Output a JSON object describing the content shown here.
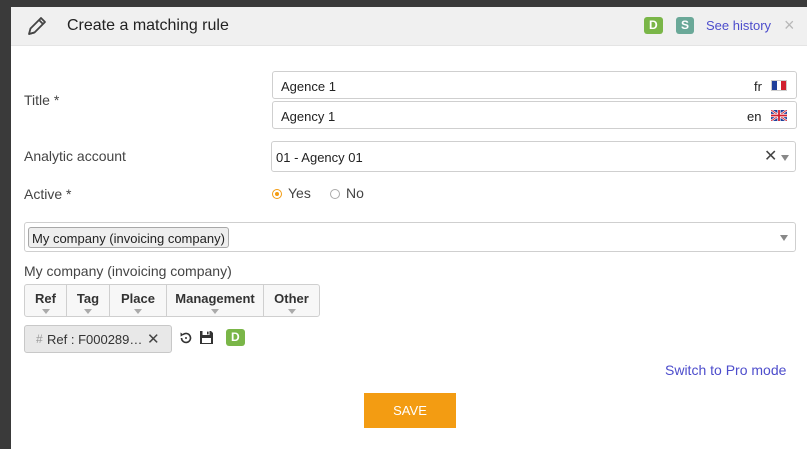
{
  "header": {
    "title": "Create a matching rule",
    "badge_d": "D",
    "badge_s": "S",
    "see_history": "See history",
    "close": "×"
  },
  "form": {
    "title_label": "Title *",
    "title_fr_value": "Agence 1",
    "title_fr_lang": "fr",
    "title_en_value": "Agency 1",
    "title_en_lang": "en",
    "analytic_label": "Analytic account",
    "analytic_value": "01 - Agency 01",
    "active_label": "Active *",
    "active_yes": "Yes",
    "active_no": "No",
    "active_selected": "Yes"
  },
  "company": {
    "select_tag": "My company (invoicing company)",
    "section_label": "My company (invoicing company)",
    "buttons": [
      "Ref",
      "Tag",
      "Place",
      "Management",
      "Other"
    ],
    "chip_text": "Ref : F000289…",
    "chip_badge": "D"
  },
  "footer": {
    "switch_pro": "Switch to Pro mode",
    "save": "SAVE"
  },
  "colors": {
    "accent": "#f39c12",
    "badge_d": "#7ab648",
    "badge_s": "#6aa898",
    "link": "#4d4dcc"
  }
}
